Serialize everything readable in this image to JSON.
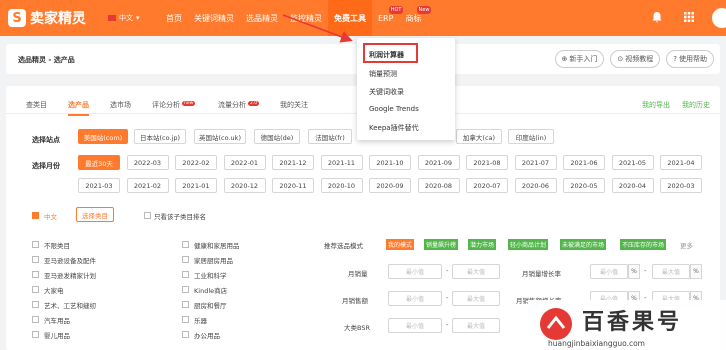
{
  "header": {
    "logo_mark": "S",
    "logo_text": "卖家精灵",
    "language": "中文",
    "nav": [
      {
        "label": "首页",
        "badge": ""
      },
      {
        "label": "关键词精灵",
        "badge": ""
      },
      {
        "label": "选品精灵",
        "badge": ""
      },
      {
        "label": "监控精灵",
        "badge": ""
      },
      {
        "label": "免费工具",
        "badge": ""
      },
      {
        "label": "ERP",
        "badge": "HOT"
      },
      {
        "label": "商标",
        "badge": "New"
      }
    ],
    "colors": {
      "brand": "#ff7a2c",
      "badge": "#e53935",
      "green": "#52b64a"
    }
  },
  "dropdown": {
    "items": [
      "利润计算器",
      "销量预测",
      "关键词收录",
      "Google Trends",
      "Keepa插件替代"
    ]
  },
  "breadcrumb": {
    "text": "选品精灵 - 选产品",
    "buttons": [
      "新手入门",
      "视频教程",
      "使用帮助"
    ]
  },
  "tabs": {
    "items": [
      {
        "label": "查类目",
        "badge": ""
      },
      {
        "label": "选产品",
        "badge": ""
      },
      {
        "label": "选市场",
        "badge": ""
      },
      {
        "label": "评论分析",
        "badge": "new"
      },
      {
        "label": "流量分析",
        "badge": "2.0"
      },
      {
        "label": "我的关注",
        "badge": ""
      }
    ],
    "right": [
      "我的导出",
      "我的历史"
    ]
  },
  "filters": {
    "site_label": "选择站点",
    "sites": [
      "美国站(com)",
      "日本站(co.jp)",
      "英国站(co.uk)",
      "德国站(de)",
      "法国站(fr)",
      "加拿大(ca)",
      "印度站(in)"
    ],
    "month_label": "选择月份",
    "months_row1": [
      "最近30天",
      "2022-03",
      "2022-02",
      "2022-01",
      "2021-12",
      "2021-11",
      "2021-10",
      "2021-09",
      "2021-08",
      "2021-07",
      "2021-06",
      "2021-05",
      "2021-04"
    ],
    "months_row2": [
      "2021-03",
      "2021-02",
      "2021-01",
      "2020-12",
      "2020-11",
      "2020-10",
      "2020-09",
      "2020-08",
      "2020-07",
      "2020-06",
      "2020-05",
      "2020-04",
      "2020-03"
    ]
  },
  "categories": {
    "lang_label": "中文",
    "select_btn": "选择类目",
    "only_label": "只看该子类目排名",
    "left": [
      "不限类目",
      "亚马逊设备及配件",
      "亚马逊发精家计划",
      "大家电",
      "艺术、工艺和缝纫",
      "汽车用品",
      "婴儿用品"
    ],
    "right": [
      "健康和家居用品",
      "家居厨房用品",
      "工业和科学",
      "Kindle商店",
      "厨房和餐厅",
      "乐器",
      "办公用品"
    ]
  },
  "mode": {
    "label": "推荐选品模式",
    "tags": [
      "我的模式",
      "销量飙升榜",
      "潜力市场",
      "轻小商品计划",
      "未被满足的市场",
      "不压库存的市场"
    ],
    "more": "更多"
  },
  "fields": {
    "monthly_sales": "月销量",
    "monthly_revenue": "月销售额",
    "bsr": "大类BSR",
    "sales_growth": "月销量增长率",
    "revenue_growth": "月销售额增长率",
    "min_placeholder": "最小值",
    "max_placeholder": "最大值",
    "dash": "-",
    "percent": "%"
  },
  "watermark": {
    "text": "百香果号",
    "url": "huangjinbaixiangguo.com"
  }
}
